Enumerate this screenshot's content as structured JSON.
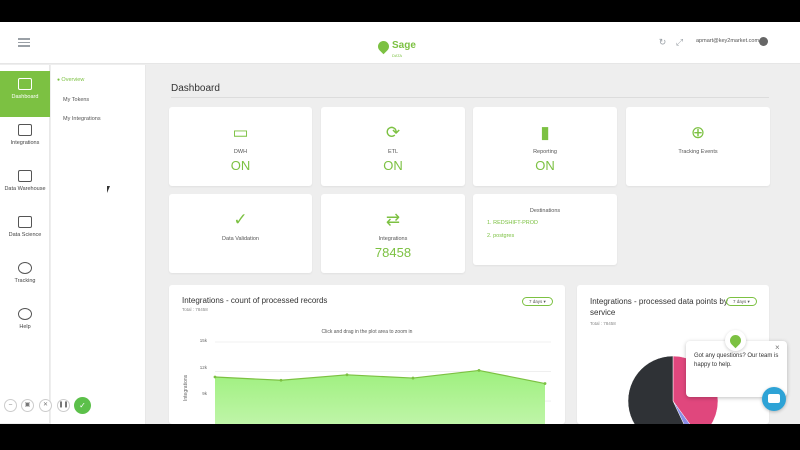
{
  "header": {
    "brand_name": "Sage",
    "brand_sub": "DATA",
    "user_email": "apmart@key2market.com",
    "icons": [
      "menu-icon",
      "refresh-icon",
      "fullscreen-icon",
      "user-avatar"
    ]
  },
  "leftnav": {
    "items": [
      {
        "label": "Dashboard",
        "icon": "monitor-icon",
        "active": true
      },
      {
        "label": "Integrations",
        "icon": "integrations-icon",
        "active": false
      },
      {
        "label": "Data Warehouse",
        "icon": "database-icon",
        "active": false
      },
      {
        "label": "Data Science",
        "icon": "chart-line-icon",
        "active": false
      },
      {
        "label": "Tracking",
        "icon": "target-icon",
        "active": false
      },
      {
        "label": "Help",
        "icon": "help-icon",
        "active": false
      }
    ]
  },
  "subnav": {
    "items": [
      {
        "label": "Overview",
        "active": true
      },
      {
        "label": "My Tokens",
        "active": false
      },
      {
        "label": "My Integrations",
        "active": false
      }
    ]
  },
  "page": {
    "title": "Dashboard"
  },
  "cards": {
    "dwh": {
      "label": "DWH",
      "value": "ON",
      "icon": "hard-drive-icon"
    },
    "etl": {
      "label": "ETL",
      "value": "ON",
      "icon": "sync-icon"
    },
    "reporting": {
      "label": "Reporting",
      "value": "ON",
      "icon": "bar-chart-icon"
    },
    "tracking": {
      "label": "Tracking Events",
      "icon": "crosshair-icon"
    },
    "validation": {
      "label": "Data Validation",
      "icon": "check-circle-icon"
    },
    "integrations": {
      "label": "Integrations",
      "value": "78458",
      "icon": "transfer-icon"
    },
    "destinations": {
      "title": "Destinations",
      "items": [
        "1. REDSHIFT-PROD",
        "2. postgres"
      ]
    }
  },
  "panels": {
    "records": {
      "title": "Integrations - count of processed records",
      "total": "Total : 78458",
      "range_label": "7 days",
      "hint": "Click and drag in the plot area to zoom in"
    },
    "points": {
      "title": "Integrations - processed data points by service",
      "total": "Total : 78458",
      "range_label": "7 days"
    }
  },
  "chart_data": [
    {
      "type": "area",
      "ylabel": "Integrations",
      "yticks": [
        "15k",
        "12k",
        "9k"
      ],
      "ylim": [
        7500,
        15000
      ],
      "x": [
        1,
        2,
        3,
        4,
        5,
        6
      ],
      "values": [
        11800,
        11500,
        12000,
        11700,
        12400,
        11200
      ],
      "color": "#7cc142"
    },
    {
      "type": "pie",
      "slices": [
        {
          "value": 40,
          "color": "#e0477d"
        },
        {
          "value": 3,
          "color": "#8a8fe8"
        },
        {
          "value": 57,
          "color": "#2f3236"
        }
      ]
    }
  ],
  "chat": {
    "message": "Got any questions? Our team is happy to help.",
    "close_label": "×"
  },
  "theme": {
    "accent": "#7cc142",
    "chat_launcher": "#2ea3d6"
  }
}
